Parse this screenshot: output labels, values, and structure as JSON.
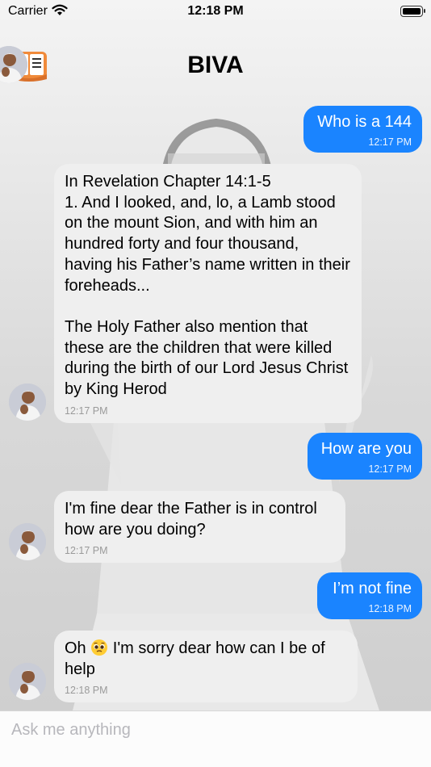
{
  "status_bar": {
    "carrier": "Carrier",
    "time": "12:18 PM",
    "battery_level": 1.0
  },
  "header": {
    "title": "BIVA",
    "menu_icon": "book-icon",
    "avatar_icon": "profile-avatar"
  },
  "messages": [
    {
      "direction": "outgoing",
      "text": "Who is a 144",
      "time": "12:17 PM"
    },
    {
      "direction": "incoming",
      "text": "In Revelation Chapter 14:1-5\n1. And I looked, and, lo, a Lamb stood on the mount Sion, and with him an hundred forty and four thousand, having his Father’s name written in their foreheads...\n\nThe Holy Father also mention that these are the children that were killed during the birth of our Lord Jesus Christ by King Herod",
      "time": "12:17 PM"
    },
    {
      "direction": "outgoing",
      "text": "How are you",
      "time": "12:17 PM"
    },
    {
      "direction": "incoming",
      "text": "I'm fine dear the Father is in control how are you doing?",
      "time": "12:17 PM"
    },
    {
      "direction": "outgoing",
      "text": "I’m not fine",
      "time": "12:18 PM"
    },
    {
      "direction": "incoming",
      "text_before_emoji": "Oh ",
      "emoji": "pleading-face-icon",
      "text_after_emoji": " I'm sorry dear how can I be of help",
      "time": "12:18 PM"
    }
  ],
  "input": {
    "placeholder": "Ask me anything",
    "value": ""
  },
  "colors": {
    "outgoing_bubble": "#1a84ff",
    "incoming_bubble": "#efefef",
    "book_icon": "#f08a3a"
  }
}
